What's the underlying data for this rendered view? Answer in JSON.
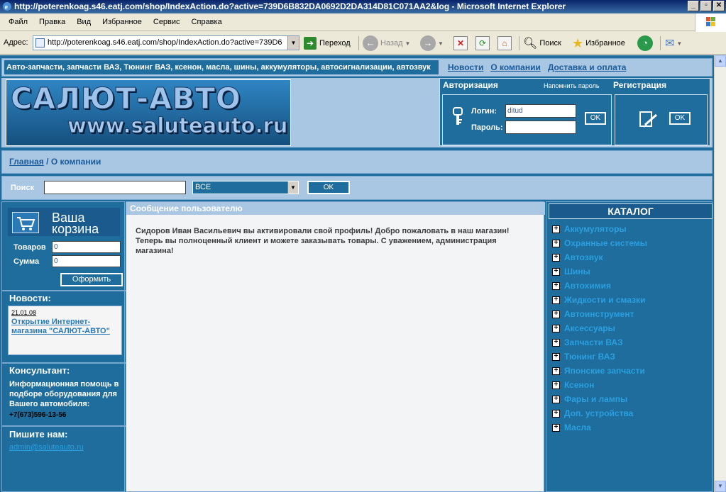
{
  "window": {
    "title": "http://poterenkoag.s46.eatj.com/shop/IndexAction.do?active=739D6B832DA0692D2DA314D81C071AA2&log - Microsoft Internet Explorer",
    "minimize": "_",
    "maximize": "▫",
    "close": "✕"
  },
  "menu": [
    "Файл",
    "Правка",
    "Вид",
    "Избранное",
    "Сервис",
    "Справка"
  ],
  "toolbar": {
    "address_label": "Адрес:",
    "address_value": "http://poterenkoag.s46.eatj.com/shop/IndexAction.do?active=739D6",
    "go_label": "Переход",
    "back_label": "Назад",
    "search_label": "Поиск",
    "favorites_label": "Избранное"
  },
  "site": {
    "slogan": "Авто-запчасти, запчасти ВАЗ, Тюнинг ВАЗ, ксенон, масла, шины, аккумуляторы, автосигнализации, автозвук",
    "nav": [
      "Новости",
      "О компании",
      "Доставка и оплата"
    ],
    "logo_line1": "САЛЮТ-АВТО",
    "logo_line2": "www.saluteauto.ru",
    "auth": {
      "title": "Авторизация",
      "remind": "Напомнить пароль",
      "login_label": "Логин:",
      "login_value": "ditud",
      "password_label": "Пароль:",
      "ok": "OK"
    },
    "register": {
      "title": "Регистрация",
      "ok": "OK"
    },
    "breadcrumb": {
      "home": "Главная",
      "separator": "/",
      "current": "О компании"
    },
    "search": {
      "label": "Поиск",
      "select_value": "ВСЕ",
      "ok": "OK"
    },
    "cart": {
      "title_line1": "Ваша",
      "title_line2": "корзина",
      "items_label": "Товаров",
      "items_value": "0",
      "sum_label": "Сумма",
      "sum_value": "0",
      "checkout": "Оформить"
    },
    "news": {
      "title": "Новости:",
      "date": "21.01.08",
      "headline": "Открытие Интернет-магазина \"САЛЮТ-АВТО\""
    },
    "consultant": {
      "title": "Консультант:",
      "text": "Информационная помощь в подборе оборудования для Вашего автомобиля:",
      "phone": "+7(673)596-13-56"
    },
    "contact": {
      "title": "Пишите нам:",
      "email": "admin@saluteauto.ru"
    },
    "message": {
      "header": "Сообщение пользователю",
      "text": "Сидоров Иван Васильевич вы активировали свой профиль! Добро пожаловать в наш магазин! Теперь вы полноценный клиент и можете заказывать товары. С уважением, администрация магазина!"
    },
    "catalog": {
      "title": "КАТАЛОГ",
      "items": [
        "Аккумуляторы",
        "Охранные системы",
        "Автозвук",
        "Шины",
        "Автохимия",
        "Жидкости и смазки",
        "Автоинструмент",
        "Аксессуары",
        "Запчасти ВАЗ",
        "Тюнинг ВАЗ",
        "Японские запчасти",
        "Ксенон",
        "Фары и лампы",
        "Доп. устройства",
        "Масла"
      ]
    }
  },
  "colors": {
    "primary": "#1e6d9c",
    "light": "#a9c7e3",
    "link": "#2b9fe0"
  }
}
